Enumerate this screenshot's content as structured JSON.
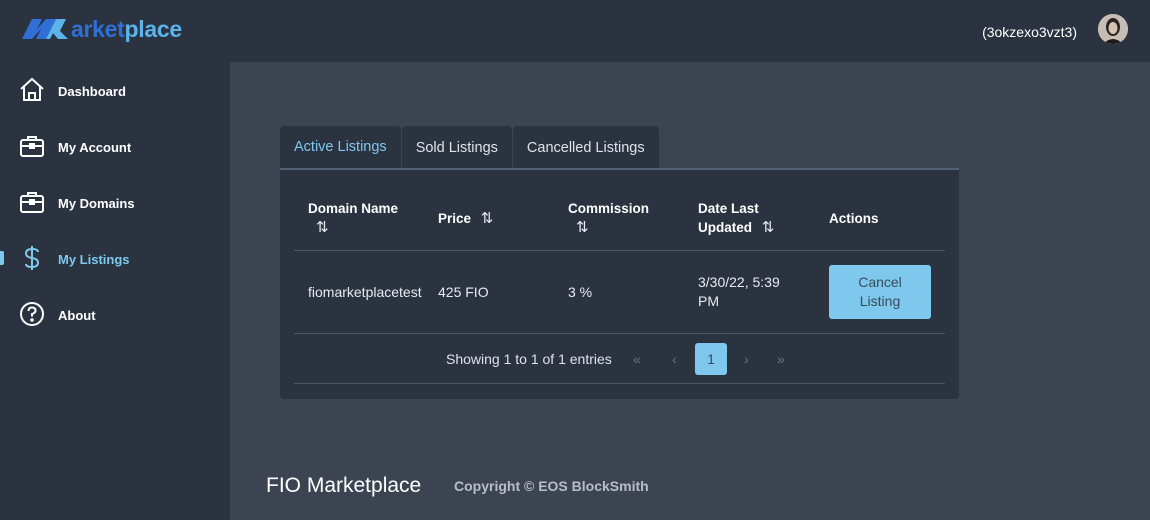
{
  "app": {
    "logo_m_icon": "m-logo-icon",
    "logo_text_arket": "arket",
    "logo_text_place": "place",
    "account_name": "(3okzexo3vzt3)",
    "avatar_icon": "avatar-icon"
  },
  "sidebar": {
    "items": [
      {
        "label": "Dashboard",
        "icon": "home-icon"
      },
      {
        "label": "My Account",
        "icon": "briefcase-icon"
      },
      {
        "label": "My Domains",
        "icon": "briefcase-icon"
      },
      {
        "label": "My Listings",
        "icon": "dollar-icon",
        "active": true
      },
      {
        "label": "About",
        "icon": "question-circle-icon"
      }
    ]
  },
  "tabs": [
    {
      "label": "Active Listings",
      "active": true
    },
    {
      "label": "Sold Listings"
    },
    {
      "label": "Cancelled Listings"
    }
  ],
  "table": {
    "headers": {
      "domain": "Domain Name",
      "price": "Price",
      "commission": "Commission",
      "date_line1": "Date Last",
      "date_line2": "Updated",
      "actions": "Actions"
    },
    "sort_icon": "⇅",
    "rows": [
      {
        "domain": "fiomarketplacetest",
        "price": "425 FIO",
        "commission": "3 %",
        "date_line1": "3/30/22, 5:39",
        "date_line2": "PM",
        "action_line1": "Cancel",
        "action_line2": "Listing"
      }
    ]
  },
  "pagination": {
    "summary": "Showing 1 to 1 of 1 entries",
    "first": "«",
    "prev": "‹",
    "current": "1",
    "next": "›",
    "last": "»"
  },
  "footer": {
    "title": "FIO Marketplace",
    "copyright": "Copyright © EOS BlockSmith"
  },
  "colors": {
    "accent": "#7ec8ee",
    "sidebar_bg": "#2b3341",
    "content_bg": "#3d4451",
    "logo_dark_blue": "#2f6fd6",
    "logo_light_blue": "#5cb3e9"
  }
}
